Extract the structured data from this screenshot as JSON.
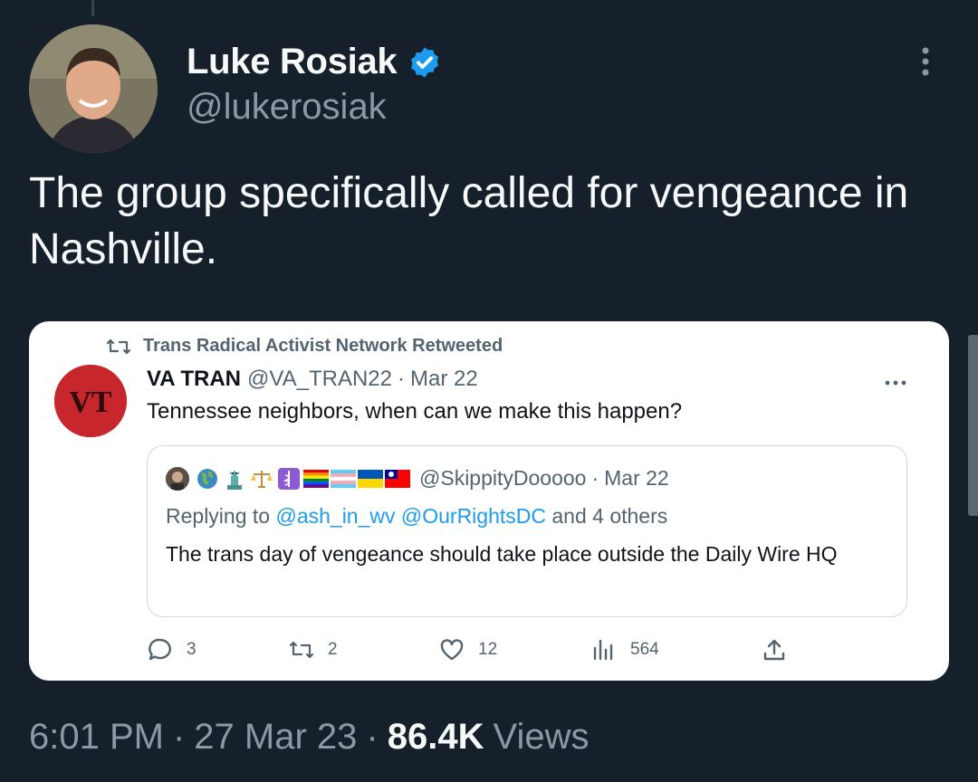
{
  "author": {
    "name": "Luke Rosiak",
    "handle": "@lukerosiak",
    "verified": true,
    "accent_color": "#1d9bf0"
  },
  "tweet": {
    "text": "The group specifically called for vengeance in Nashville."
  },
  "embedded_screenshot": {
    "retweet_label": "Trans Radical Activist Network Retweeted",
    "post": {
      "name": "VA TRAN",
      "handle": "@VA_TRAN22",
      "separator": "·",
      "date": "Mar 22",
      "avatar_text": "VT",
      "text": "Tennessee neighbors, when can we make this happen?"
    },
    "quoted": {
      "name_emojis": [
        "globe-emoji",
        "statue-of-liberty-emoji",
        "scales-emoji",
        "medical-symbol-emoji",
        "rainbow-flag-emoji",
        "trans-flag-emoji",
        "ukraine-flag-emoji",
        "taiwan-flag-emoji"
      ],
      "handle": "@SkippityDooooo",
      "separator": "·",
      "date": "Mar 22",
      "reply_prefix": "Replying to",
      "reply_targets": "@ash_in_wv @OurRightsDC",
      "reply_suffix": "and 4 others",
      "text": "The trans day of vengeance should take place outside the Daily Wire HQ"
    },
    "actions": {
      "replies": "3",
      "retweets": "2",
      "likes": "12",
      "views": "564"
    }
  },
  "meta": {
    "time": "6:01 PM",
    "separator": "·",
    "date": "27 Mar 23",
    "views_count": "86.4K",
    "views_label": "Views"
  }
}
